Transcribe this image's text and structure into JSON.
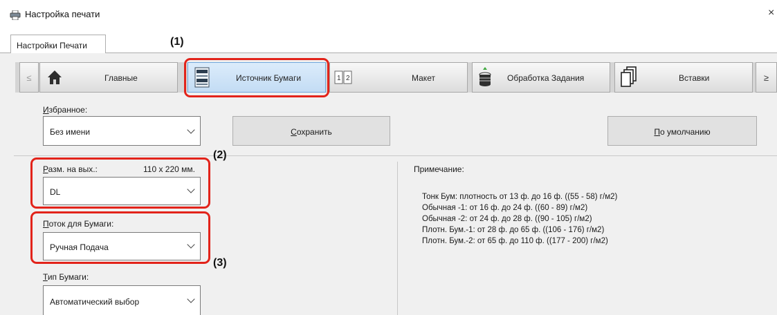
{
  "window": {
    "title": "Настройка печати",
    "close_glyph": "×"
  },
  "tabs": [
    {
      "label": "Настройки Печати"
    }
  ],
  "toolbar": {
    "prev_glyph": "≤",
    "next_glyph": "≥",
    "items": [
      {
        "label": "Главные",
        "icon": "home-icon"
      },
      {
        "label": "Источник Бумаги",
        "icon": "paper-source-icon",
        "selected": true
      },
      {
        "label": "Макет",
        "icon": "layout-icon",
        "icon_text": "1|2"
      },
      {
        "label": "Обработка Задания",
        "icon": "job-handling-icon"
      },
      {
        "label": "Вставки",
        "icon": "inserts-icon"
      }
    ]
  },
  "callouts": {
    "c1": "(1)",
    "c2": "(2)",
    "c3": "(3)"
  },
  "favorites": {
    "label_ul": "И",
    "label_rest": "збранное:",
    "value": "Без имени",
    "save_ul": "С",
    "save_rest": "охранить",
    "default_ul": "П",
    "default_rest": "о умолчанию"
  },
  "output_size": {
    "label_ul": "Р",
    "label_rest": "азм. на вых.:",
    "dimensions": "110 x 220 мм.",
    "value": "DL"
  },
  "paper_source": {
    "label_ul": "П",
    "label_rest": "оток для Бумаги:",
    "value": "Ручная Подача"
  },
  "paper_type": {
    "label_ul": "Т",
    "label_rest": "ип Бумаги:",
    "value": "Автоматический выбор"
  },
  "notes": {
    "title": "Примечание:",
    "lines": [
      "Тонк Бум: плотность от 13 ф. до 16 ф. ((55 - 58) г/м2)",
      "Обычная -1: от 16 ф. до 24 ф. ((60 - 89) г/м2)",
      "Обычная -2: от 24 ф. до 28 ф. ((90 - 105) г/м2)",
      "Плотн. Бум.-1: от 28 ф. до 65 ф. ((106 - 176) г/м2)",
      "Плотн. Бум.-2: от 65 ф. до 110 ф. ((177 - 200) г/м2)"
    ]
  },
  "colors": {
    "accent_selected": "#c3dcf4",
    "callout_red": "#e2231a",
    "panel": "#f0f0f0"
  }
}
